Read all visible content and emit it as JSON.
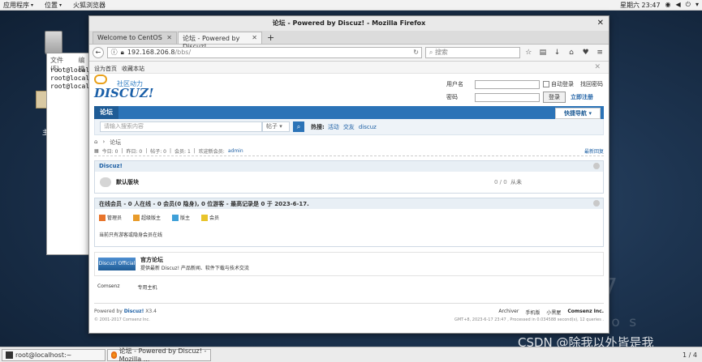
{
  "topbar": {
    "apps": "应用程序",
    "places": "位置",
    "firefox": "火狐浏览器",
    "clock": "星期六 23:47"
  },
  "desktop": {
    "folder_label": "主",
    "watermark_num": "7",
    "watermark_os": "r o s",
    "csdn": "CSDN @除我以外皆是我"
  },
  "terminal": {
    "menu_file": "文件(F)",
    "menu_edit": "编辑",
    "lines": [
      "root@local",
      "root@local",
      "root@local"
    ]
  },
  "browser": {
    "title": "论坛 - Powered by Discuz! - Mozilla Firefox",
    "tabs": [
      {
        "label": "Welcome to CentOS"
      },
      {
        "label": "论坛 - Powered by Discuz!"
      }
    ],
    "url_host": "192.168.206.8",
    "url_path": "/bbs/",
    "search_placeholder": "搜索"
  },
  "page": {
    "toplinks": [
      "设为首页",
      "收藏本站"
    ],
    "logo_tag": "社区动力",
    "logo_brand": "DISCUZ!",
    "login": {
      "username_label": "用户名",
      "password_label": "密码",
      "auto_login": "自动登录",
      "forgot": "找回密码",
      "login_btn": "登录",
      "register": "立即注册"
    },
    "nav": {
      "item": "论坛",
      "quick": "快捷导航"
    },
    "search": {
      "placeholder": "请输入搜索内容",
      "type": "帖子",
      "hot_label": "热搜:",
      "hot": [
        "活动",
        "交友",
        "discuz"
      ]
    },
    "crumb": "论坛",
    "stats": {
      "today": "今日: 0",
      "yesterday": "昨日: 0",
      "posts": "帖子: 0",
      "members": "会员: 1",
      "welcome": "欢迎新会员:",
      "admin": "admin",
      "latest": "最新回复"
    },
    "category": {
      "name": "Discuz!",
      "forum": "默认版块",
      "count": "0 / 0",
      "last": "从未"
    },
    "online": {
      "header": "在线会员 - 0 人在线 - 0 会员(0 隐身), 0 位游客 - 最高记录是 0 于 2023-6-17.",
      "legend": [
        "管理员",
        "超级版主",
        "版主",
        "会员"
      ],
      "note": "当前只有游客或隐身会员在线"
    },
    "official": {
      "logo": "Discuz! Official",
      "title": "官方论坛",
      "desc": "提供最新 Discuz! 产品新闻、软件下载与技术交流"
    },
    "links": [
      "Comsenz",
      "专用主机"
    ],
    "footer": {
      "powered": "Powered by",
      "discuz": "Discuz!",
      "version": "X3.4",
      "copyright": "© 2001-2017 Comsenz Inc.",
      "right_links": [
        "Archiver",
        "手机版",
        "小黑屋"
      ],
      "company": "Comsenz Inc.",
      "gmt": "GMT+8, 2023-6-17 23:47 , Processed in 0.034588 second(s), 12 queries ."
    }
  },
  "taskbar": {
    "terminal": "root@localhost:~",
    "firefox": "论坛 - Powered by Discuz! - Mozilla ...",
    "pager": "1 / 4"
  },
  "colors": {
    "discuz_blue": "#2b73b7",
    "link": "#1c5fa4"
  }
}
